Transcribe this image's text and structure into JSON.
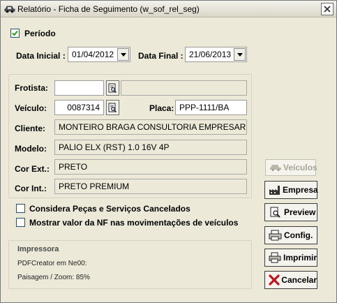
{
  "window": {
    "title": "Relatório - Ficha de Seguimento (w_sof_rel_seg)",
    "icon": "car-icon"
  },
  "periodo": {
    "label": "Período",
    "checked": true,
    "data_inicial_label": "Data Inicial :",
    "data_inicial_value": "01/04/2012",
    "data_final_label": "Data Final :",
    "data_final_value": "21/06/2013"
  },
  "form": {
    "frotista_label": "Frotista:",
    "frotista_value": "",
    "frotista_name": "",
    "veiculo_label": "Veículo:",
    "veiculo_value": "0087314",
    "placa_label": "Placa:",
    "placa_value": "PPP-1111/BA",
    "cliente_label": "Cliente:",
    "cliente_value": "MONTEIRO BRAGA CONSULTORIA EMPRESARIA",
    "modelo_label": "Modelo:",
    "modelo_value": "PALIO ELX (RST) 1.0 16V 4P",
    "cor_ext_label": "Cor Ext.:",
    "cor_ext_value": "PRETO",
    "cor_int_label": "Cor Int.:",
    "cor_int_value": "PRETO PREMIUM"
  },
  "options": {
    "considera_label": "Considera Peças e Serviços Cancelados",
    "considera_checked": false,
    "mostrar_label": "Mostrar valor da NF nas movimentações de veículos",
    "mostrar_checked": false
  },
  "impressora": {
    "title": "Impressora",
    "printer": "PDFCreator em Ne00:",
    "orientation": "Paisagem / Zoom: 85%"
  },
  "buttons": {
    "veiculos": "Veículos",
    "empresa": "Empresa",
    "preview": "Preview",
    "config": "Config.",
    "imprimir": "Imprimir",
    "cancelar": "Cancelar"
  }
}
